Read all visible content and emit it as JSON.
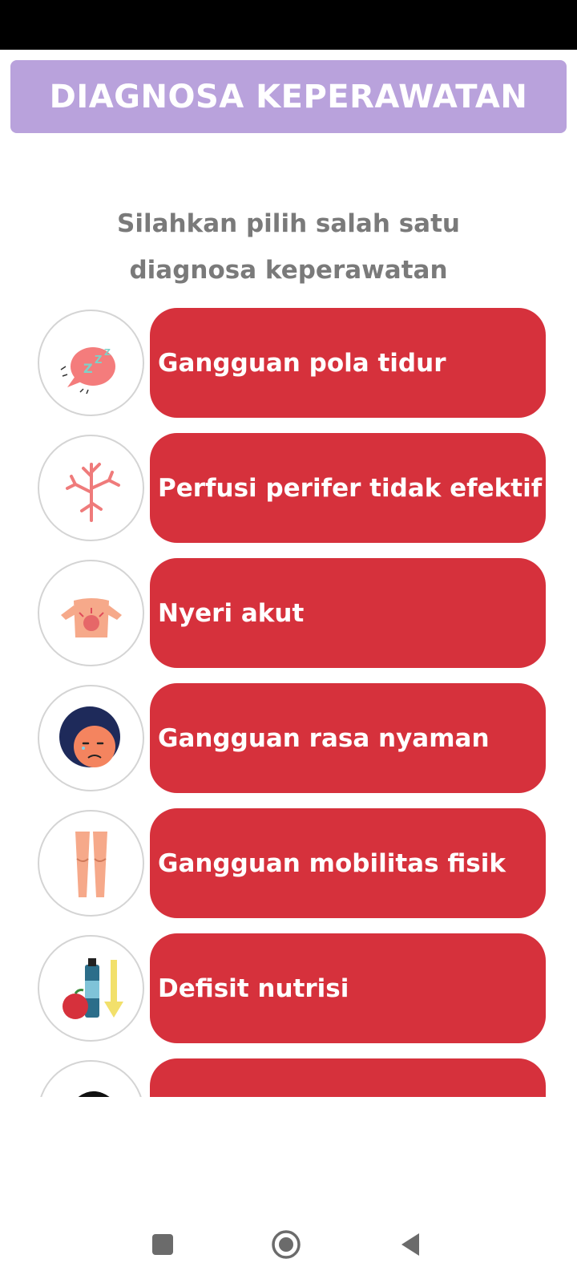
{
  "header": {
    "title": "DIAGNOSA KEPERAWATAN"
  },
  "subtitle": {
    "line1": "Silahkan pilih salah satu",
    "line2": "diagnosa keperawatan"
  },
  "diagnoses": [
    {
      "label": "Gangguan pola tidur",
      "icon": "sleep-icon"
    },
    {
      "label": "Perfusi perifer tidak efektif",
      "icon": "blood-vessel-icon"
    },
    {
      "label": "Nyeri akut",
      "icon": "back-pain-icon"
    },
    {
      "label": "Gangguan rasa nyaman",
      "icon": "uncomfortable-face-icon"
    },
    {
      "label": "Gangguan mobilitas fisik",
      "icon": "legs-icon"
    },
    {
      "label": "Defisit nutrisi",
      "icon": "nutrition-icon"
    },
    {
      "label": "",
      "icon": "person-hair-icon"
    }
  ],
  "colors": {
    "header_bg": "#b9a2dc",
    "button_bg": "#d6313c",
    "subtitle_text": "#7a7a7a"
  },
  "nav": {
    "icons": [
      "recent-apps-icon",
      "home-icon",
      "back-icon"
    ]
  }
}
